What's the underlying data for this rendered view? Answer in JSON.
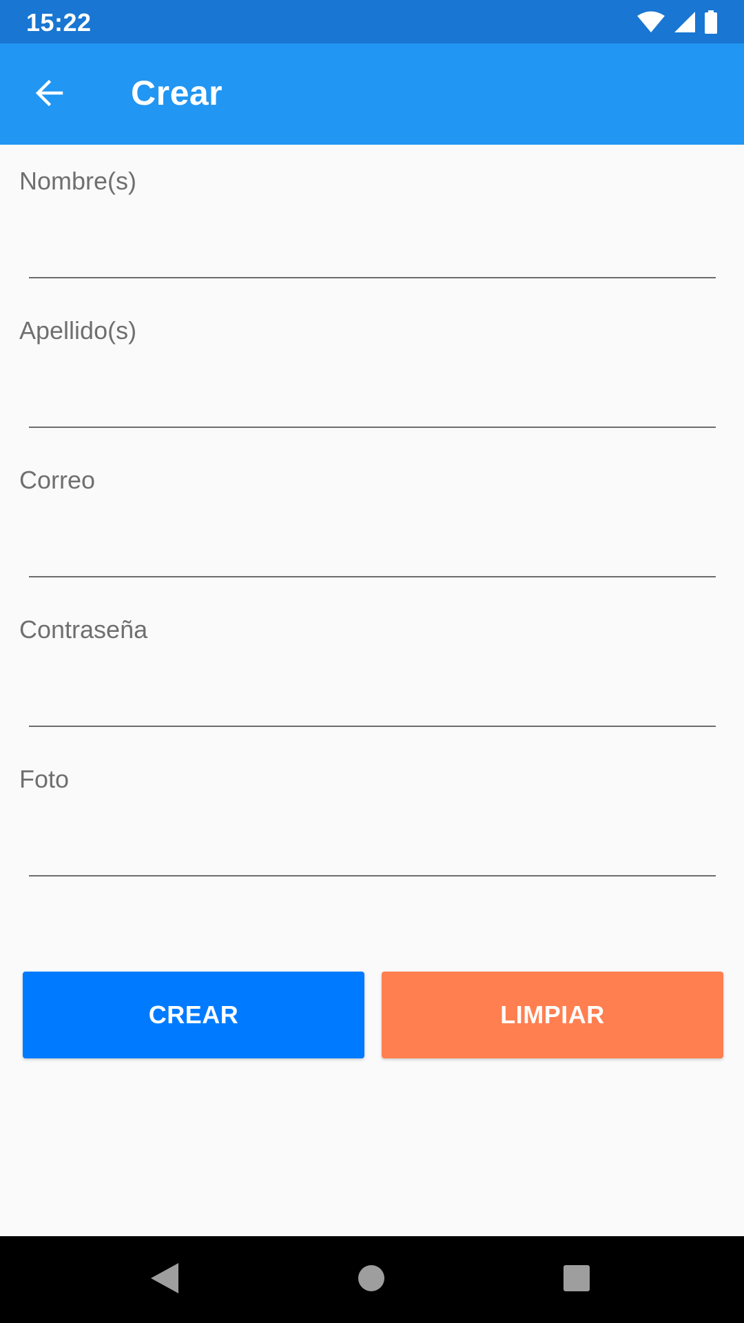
{
  "status_bar": {
    "time": "15:22",
    "icons": [
      "wifi-icon",
      "signal-icon",
      "battery-icon"
    ]
  },
  "app_bar": {
    "title": "Crear",
    "back_icon": "arrow-back-icon"
  },
  "form": {
    "fields": [
      {
        "label": "Nombre(s)",
        "value": ""
      },
      {
        "label": "Apellido(s)",
        "value": ""
      },
      {
        "label": "Correo",
        "value": ""
      },
      {
        "label": "Contraseña",
        "value": ""
      },
      {
        "label": "Foto",
        "value": ""
      }
    ]
  },
  "buttons": {
    "create_label": "CREAR",
    "clear_label": "LIMPIAR"
  },
  "nav_bar": {
    "icons": [
      "nav-back-icon",
      "nav-home-icon",
      "nav-recents-icon"
    ]
  },
  "colors": {
    "status_bar": "#1976d2",
    "app_bar": "#2196f3",
    "create_button": "#007bff",
    "clear_button": "#ff7f50",
    "background": "#fafafa",
    "label_text": "#6f6f6f"
  }
}
